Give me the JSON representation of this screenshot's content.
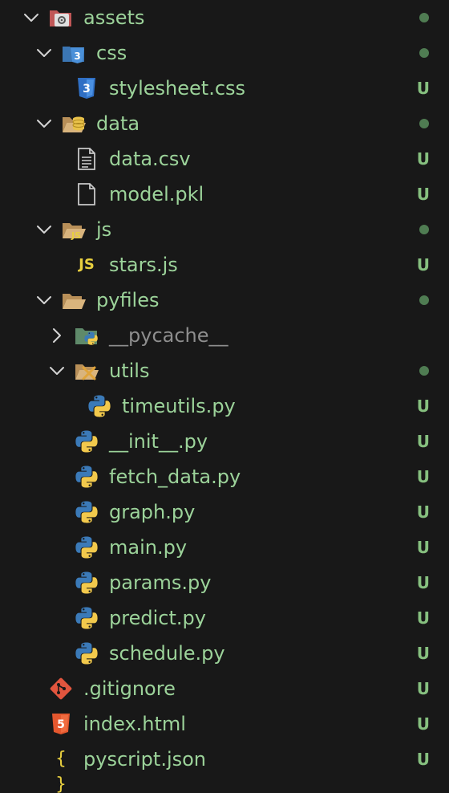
{
  "tree": {
    "assets": {
      "label": "assets"
    },
    "css": {
      "label": "css"
    },
    "stylesheet": {
      "label": "stylesheet.css",
      "status": "U"
    },
    "data": {
      "label": "data"
    },
    "data_csv": {
      "label": "data.csv",
      "status": "U"
    },
    "model_pkl": {
      "label": "model.pkl",
      "status": "U"
    },
    "js": {
      "label": "js"
    },
    "stars_js": {
      "label": "stars.js",
      "status": "U",
      "badge": "JS"
    },
    "pyfiles": {
      "label": "pyfiles"
    },
    "pycache": {
      "label": "__pycache__"
    },
    "utils": {
      "label": "utils"
    },
    "timeutils": {
      "label": "timeutils.py",
      "status": "U"
    },
    "init": {
      "label": "__init__.py",
      "status": "U"
    },
    "fetch_data": {
      "label": "fetch_data.py",
      "status": "U"
    },
    "graph": {
      "label": "graph.py",
      "status": "U"
    },
    "main": {
      "label": "main.py",
      "status": "U"
    },
    "params": {
      "label": "params.py",
      "status": "U"
    },
    "predict": {
      "label": "predict.py",
      "status": "U"
    },
    "schedule": {
      "label": "schedule.py",
      "status": "U"
    },
    "gitignore": {
      "label": ".gitignore",
      "status": "U"
    },
    "index_html": {
      "label": "index.html",
      "status": "U"
    },
    "pyscript": {
      "label": "pyscript.json",
      "status": "U",
      "badge": "{ }"
    }
  },
  "colors": {
    "background": "#181818",
    "untracked_text": "#9cd39a",
    "ignored_text": "#8e8e8e",
    "status_u": "#86c07f",
    "modified_dot": "#4f7c52"
  },
  "icons": {
    "assets": "folder-assets-icon",
    "css": "folder-css-icon",
    "data": "folder-database-icon",
    "js": "folder-js-icon",
    "pyfiles": "folder-icon",
    "pycache": "folder-python-icon",
    "utils": "folder-utils-icon",
    "python": "python-icon",
    "css_file": "css3-icon",
    "csv": "document-lines-icon",
    "pkl": "file-icon",
    "git": "git-icon",
    "html": "html5-icon",
    "json": "json-braces-icon",
    "chevron_down": "chevron-down-icon",
    "chevron_right": "chevron-right-icon"
  }
}
